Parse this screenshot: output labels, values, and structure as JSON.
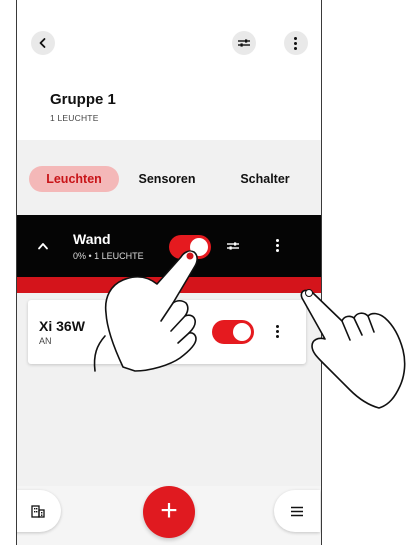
{
  "group": {
    "title": "Gruppe 1",
    "subtitle": "1 LEUCHTE"
  },
  "tabs": [
    {
      "label": "Leuchten",
      "active": true
    },
    {
      "label": "Sensoren",
      "active": false
    },
    {
      "label": "Schalter",
      "active": false
    }
  ],
  "room": {
    "name": "Wand",
    "status": "0% • 1 LEUCHTE",
    "toggle_on": true
  },
  "lamp": {
    "name": "Xi 36W",
    "status": "AN",
    "toggle_on": true
  },
  "fab": {
    "label": "+"
  },
  "icons": [
    "back-arrow-icon",
    "sliders-icon",
    "more-vertical-icon",
    "chevron-up-icon",
    "building-icon",
    "menu-icon",
    "plus-icon"
  ],
  "colors": {
    "accent": "#e01a20",
    "tab_active_bg": "#f4b8b8",
    "room_bar": "#050505"
  }
}
